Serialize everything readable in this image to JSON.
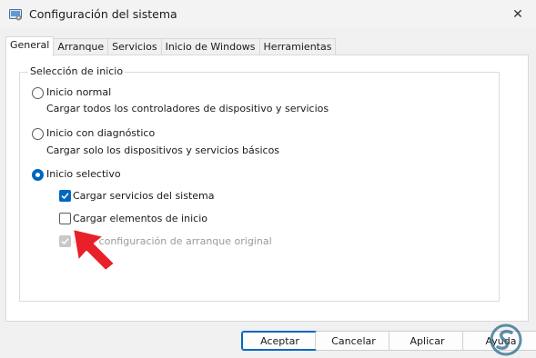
{
  "window": {
    "title": "Configuración del sistema",
    "close_glyph": "✕"
  },
  "tabs": [
    {
      "label": "General",
      "active": true
    },
    {
      "label": "Arranque",
      "active": false
    },
    {
      "label": "Servicios",
      "active": false
    },
    {
      "label": "Inicio de Windows",
      "active": false
    },
    {
      "label": "Herramientas",
      "active": false
    }
  ],
  "startup_selection": {
    "legend": "Selección de inicio",
    "normal": {
      "label": "Inicio normal",
      "description": "Cargar todos los controladores de dispositivo y servicios",
      "selected": false
    },
    "diagnostic": {
      "label": "Inicio con diagnóstico",
      "description": "Cargar solo los dispositivos y servicios básicos",
      "selected": false
    },
    "selective": {
      "label": "Inicio selectivo",
      "selected": true,
      "options": [
        {
          "label": "Cargar servicios del sistema",
          "checked": true,
          "enabled": true
        },
        {
          "label": "Cargar elementos de inicio",
          "checked": false,
          "enabled": true
        },
        {
          "label": "Usar configuración de arranque original",
          "checked": true,
          "enabled": false
        }
      ]
    }
  },
  "buttons": {
    "accept": "Aceptar",
    "cancel": "Cancelar",
    "apply": "Aplicar",
    "help": "Ayuda"
  },
  "colors": {
    "accent": "#0067c0",
    "annotation_arrow": "#e8202a",
    "watermark": "#2a6a8a"
  },
  "icons": {
    "app": "system-config-icon",
    "annotation": "red-arrow-pointer"
  }
}
